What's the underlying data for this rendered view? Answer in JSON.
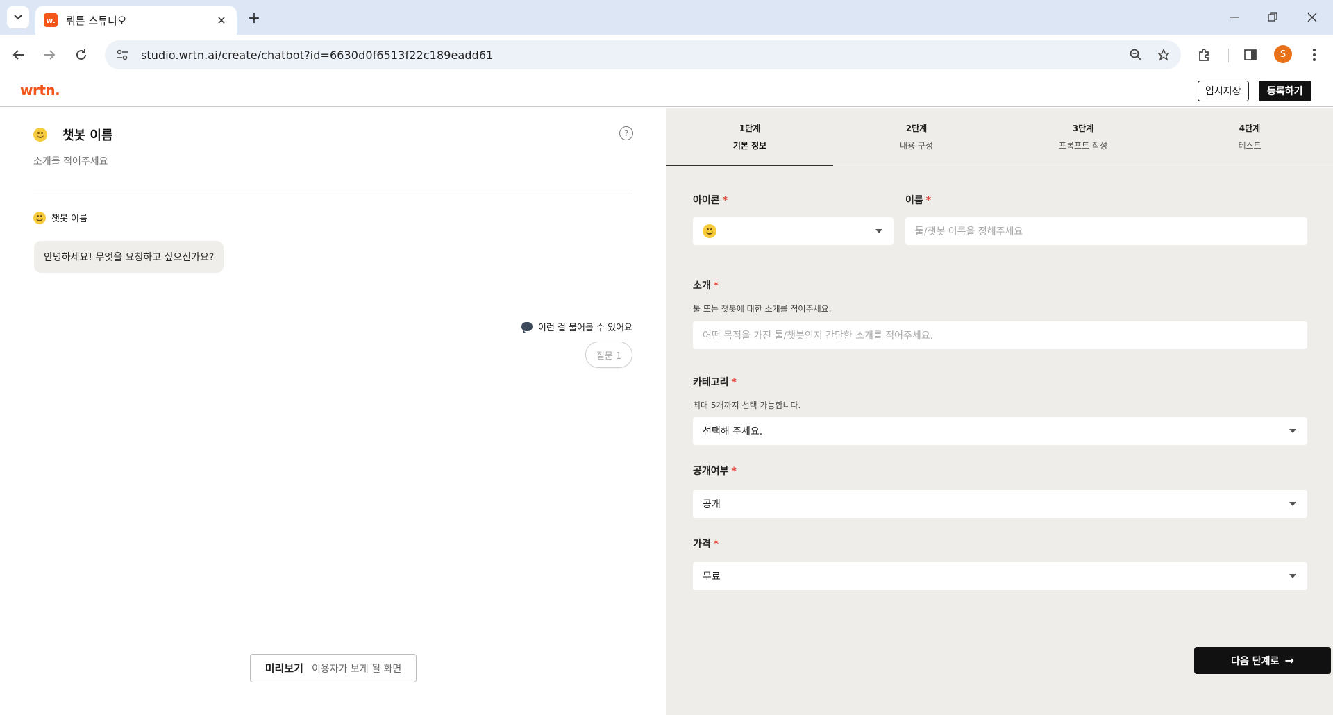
{
  "browser": {
    "tab_title": "뤼튼 스튜디오",
    "favicon_text": "w.",
    "url": "studio.wrtn.ai/create/chatbot?id=6630d0f6513f22c189eadd61",
    "profile_initial": "S"
  },
  "header": {
    "logo": "wrtn.",
    "save_label": "임시저장",
    "register_label": "등록하기"
  },
  "preview": {
    "bot_name": "챗봇 이름",
    "intro_placeholder": "소개를 적어주세요",
    "chat_name": "챗봇 이름",
    "greeting": "안녕하세요! 무엇을 요청하고 싶으신가요?",
    "suggest_label": "이런 걸 물어볼 수 있어요",
    "question_chip": "질문 1",
    "preview_label": "미리보기",
    "preview_sub": "이용자가 보게 될 화면"
  },
  "steps": [
    {
      "num": "1단계",
      "label": "기본 정보",
      "active": true
    },
    {
      "num": "2단계",
      "label": "내용 구성",
      "active": false
    },
    {
      "num": "3단계",
      "label": "프롬프트 작성",
      "active": false
    },
    {
      "num": "4단계",
      "label": "테스트",
      "active": false
    }
  ],
  "form": {
    "icon_label": "아이콘",
    "name_label": "이름",
    "name_placeholder": "툴/챗봇 이름을 정해주세요",
    "intro_label": "소개",
    "intro_help": "툴 또는 챗봇에 대한 소개를 적어주세요.",
    "intro_placeholder": "어떤 목적을 가진 툴/챗봇인지 간단한 소개를 적어주세요.",
    "category_label": "카테고리",
    "category_help": "최대 5개까지 선택 가능합니다.",
    "category_value": "선택해 주세요.",
    "visibility_label": "공개여부",
    "visibility_value": "공개",
    "price_label": "가격",
    "price_value": "무료",
    "required_mark": "*",
    "next_label": "다음 단계로"
  },
  "colors": {
    "brand": "#f2561b",
    "right_bg": "#efede9",
    "required": "#e0463a"
  }
}
